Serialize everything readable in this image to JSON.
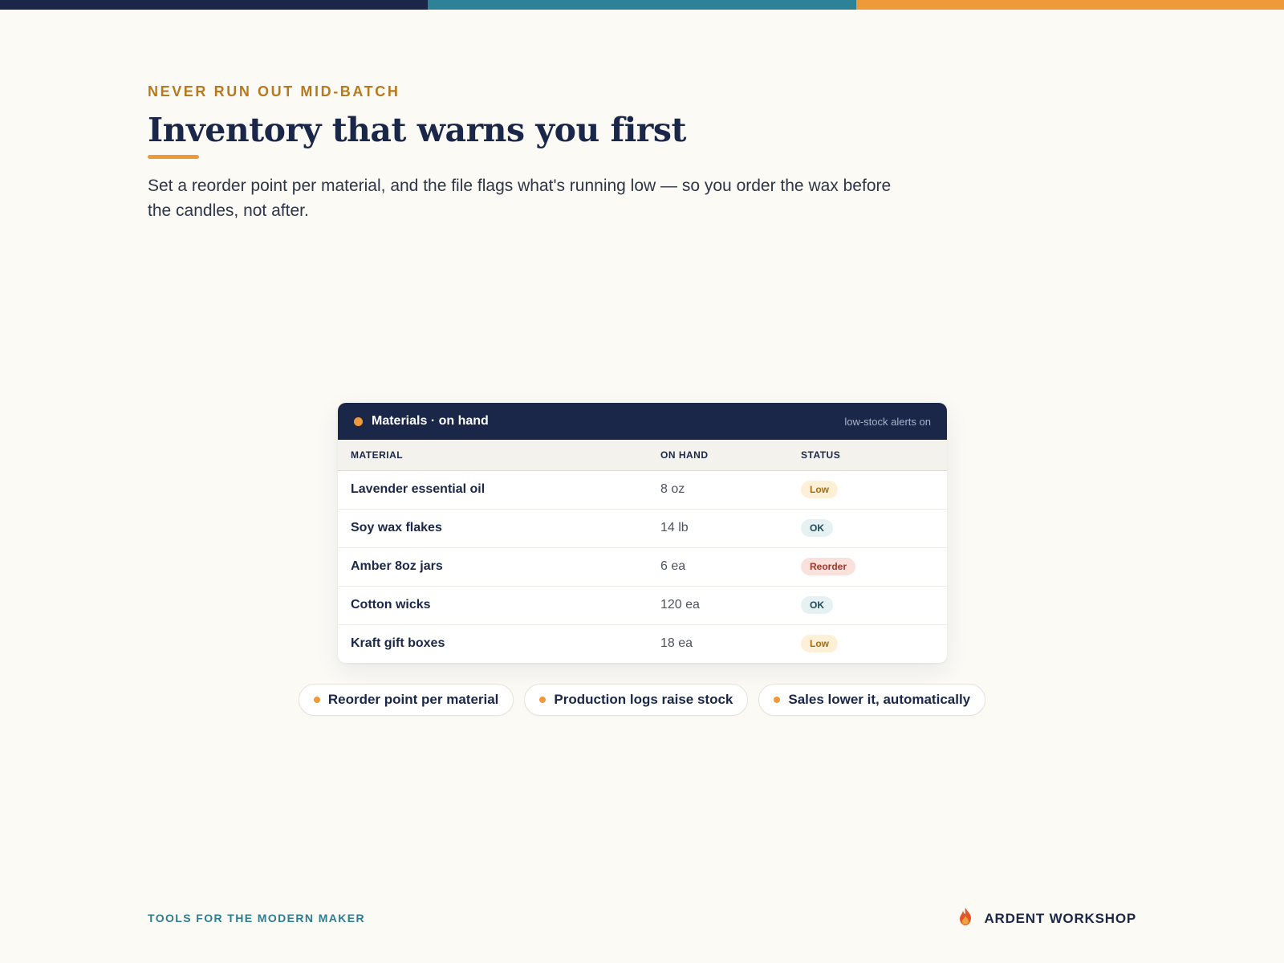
{
  "colors": {
    "navy": "#1b2748",
    "teal": "#2e8295",
    "orange": "#ee9a3a",
    "eyebrow": "#b8791c",
    "footer_teal": "#2e7c8f",
    "background": "#fbfaf5"
  },
  "hero": {
    "eyebrow": "NEVER RUN OUT MID-BATCH",
    "headline": "Inventory that warns you first",
    "lede": "Set a reorder point per material, and the file flags what's running low — so you order the wax before the candles, not after."
  },
  "card": {
    "title": "Materials · on hand",
    "meta": "low-stock alerts on",
    "columns": [
      "MATERIAL",
      "ON HAND",
      "STATUS"
    ],
    "rows": [
      {
        "material": "Lavender essential oil",
        "on_hand": "8 oz",
        "status": "Low",
        "status_kind": "low"
      },
      {
        "material": "Soy wax flakes",
        "on_hand": "14 lb",
        "status": "OK",
        "status_kind": "ok"
      },
      {
        "material": "Amber 8oz jars",
        "on_hand": "6 ea",
        "status": "Reorder",
        "status_kind": "reorder"
      },
      {
        "material": "Cotton wicks",
        "on_hand": "120 ea",
        "status": "OK",
        "status_kind": "ok"
      },
      {
        "material": "Kraft gift boxes",
        "on_hand": "18 ea",
        "status": "Low",
        "status_kind": "low"
      }
    ]
  },
  "pills": [
    "Reorder point per material",
    "Production logs raise stock",
    "Sales lower it, automatically"
  ],
  "footer": {
    "tagline": "TOOLS FOR THE MODERN MAKER",
    "brand": "ARDENT WORKSHOP",
    "brand_icon": "flame-icon"
  }
}
